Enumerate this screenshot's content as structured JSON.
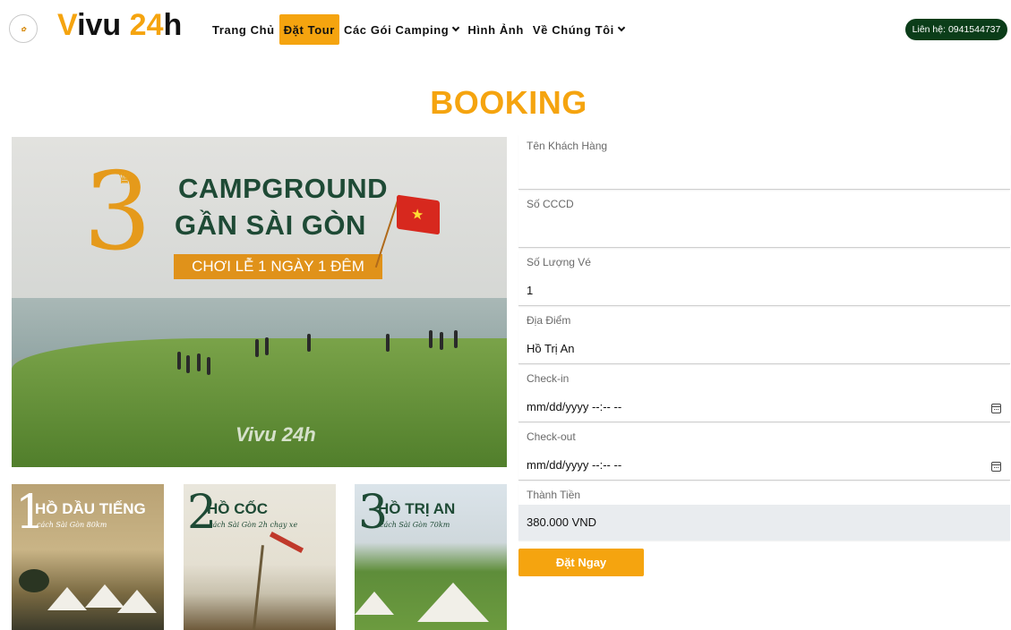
{
  "header": {
    "brand_v": "V",
    "brand_rest": "ivu ",
    "brand_num": "24",
    "brand_h": "h",
    "nav": [
      {
        "label": "Trang Chủ"
      },
      {
        "label": "Đặt Tour"
      },
      {
        "label": "Các Gói Camping"
      },
      {
        "label": "Hình Ảnh"
      },
      {
        "label": "Về Chúng Tôi"
      }
    ],
    "contact_label": "Liên hệ: 0941544737"
  },
  "page_title": "BOOKING",
  "hero": {
    "number": "3",
    "line1": "CAMPGROUND",
    "line2": "GẦN SÀI GÒN",
    "banner": "CHƠI LỄ 1 NGÀY 1 ĐÊM",
    "watermark": "Vivu 24h"
  },
  "thumbnails": [
    {
      "number": "1",
      "name": "HỒ DẦU TIẾNG",
      "sub": "cách Sài Gòn 80km"
    },
    {
      "number": "2",
      "name": "HỒ CỐC",
      "sub": "cách Sài Gòn 2h chạy xe"
    },
    {
      "number": "3",
      "name": "HỒ TRỊ AN",
      "sub": "cách Sài Gòn 70km"
    }
  ],
  "form": {
    "customer_name": {
      "label": "Tên Khách Hàng",
      "value": ""
    },
    "id_number": {
      "label": "Số CCCD",
      "value": ""
    },
    "tickets": {
      "label": "Số Lượng Vé",
      "value": "1"
    },
    "location": {
      "label": "Địa Điểm",
      "value": "Hồ Trị An"
    },
    "checkin": {
      "label": "Check-in",
      "placeholder": "mm/dd/yyyy --:-- --"
    },
    "checkout": {
      "label": "Check-out",
      "placeholder": "mm/dd/yyyy --:-- --"
    },
    "total": {
      "label": "Thành Tiền",
      "value": "380.000 VND"
    },
    "submit_label": "Đặt Ngay"
  },
  "colors": {
    "accent": "#f5a40f",
    "contact_bg": "#0b3d19",
    "readonly_bg": "#e9ecef"
  }
}
